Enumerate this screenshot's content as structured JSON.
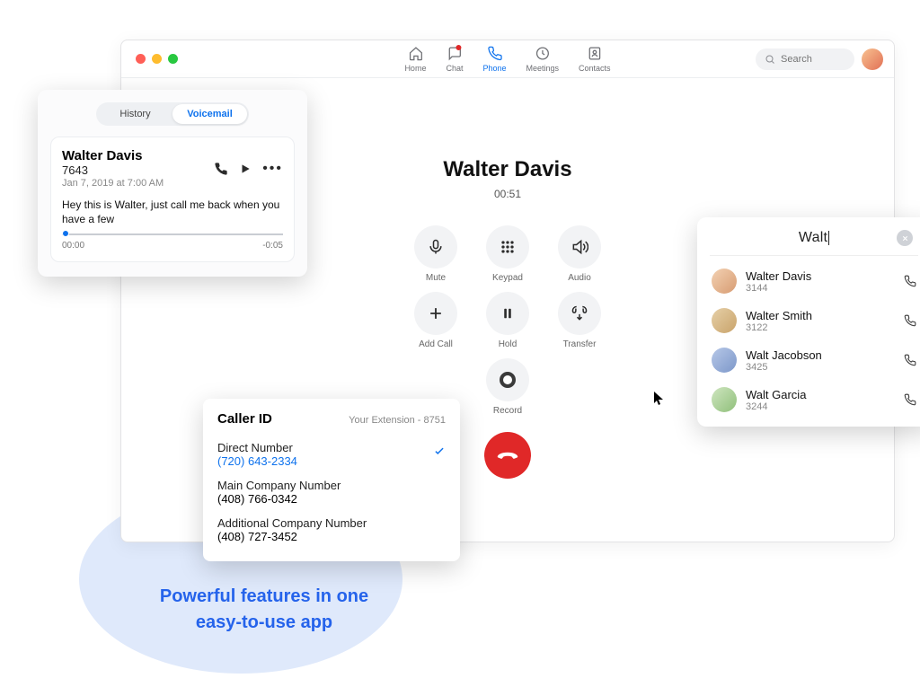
{
  "header": {
    "tabs": [
      {
        "label": "Home"
      },
      {
        "label": "Chat"
      },
      {
        "label": "Phone"
      },
      {
        "label": "Meetings"
      },
      {
        "label": "Contacts"
      }
    ],
    "search_placeholder": "Search"
  },
  "call": {
    "name": "Walter Davis",
    "timer": "00:51",
    "controls": {
      "mute": "Mute",
      "keypad": "Keypad",
      "audio": "Audio",
      "add_call": "Add Call",
      "hold": "Hold",
      "transfer": "Transfer",
      "record": "Record"
    }
  },
  "voicemail": {
    "seg_history": "History",
    "seg_voicemail": "Voicemail",
    "name": "Walter Davis",
    "ext": "7643",
    "date": "Jan 7, 2019 at 7:00 AM",
    "transcript": "Hey this is Walter, just call me back when you have a few",
    "time_start": "00:00",
    "time_end": "-0:05"
  },
  "caller_id": {
    "title": "Caller ID",
    "your_ext": "Your Extension - 8751",
    "items": [
      {
        "label": "Direct Number",
        "number": "(720) 643-2334",
        "active": true
      },
      {
        "label": "Main Company Number",
        "number": "(408) 766-0342",
        "active": false
      },
      {
        "label": "Additional Company Number",
        "number": "(408) 727-3452",
        "active": false
      }
    ]
  },
  "lookup": {
    "query": "Walt",
    "results": [
      {
        "name": "Walter Davis",
        "ext": "3144"
      },
      {
        "name": "Walter Smith",
        "ext": "3122"
      },
      {
        "name": "Walt Jacobson",
        "ext": "3425"
      },
      {
        "name": "Walt Garcia",
        "ext": "3244"
      }
    ]
  },
  "marketing": {
    "line1": "Powerful features in one",
    "line2": "easy-to-use app"
  }
}
